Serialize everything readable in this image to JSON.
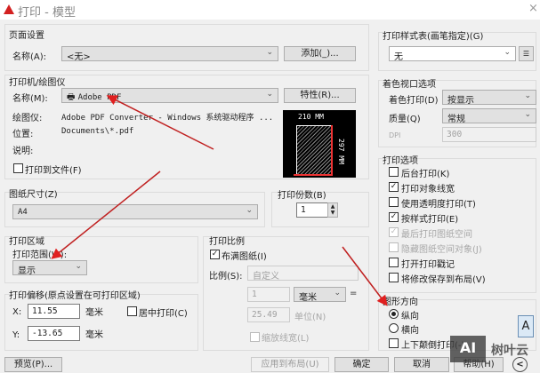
{
  "window": {
    "title": "打印 - 模型",
    "close": "×"
  },
  "page_setup": {
    "title": "页面设置",
    "name_label": "名称(A):",
    "name_value": "<无>",
    "add_button": "添加(_)..."
  },
  "printer": {
    "title": "打印机/绘图仪",
    "name_label": "名称(M):",
    "name_value": "Adobe PDF",
    "properties_button": "特性(R)...",
    "plotter_label": "绘图仪:",
    "plotter_value": "Adobe PDF Converter - Windows 系统驱动程序 ...",
    "location_label": "位置:",
    "location_value": "Documents\\*.pdf",
    "description_label": "说明:",
    "print_to_file": "打印到文件(F)",
    "preview_width": "210 MM",
    "preview_height": "297 MM"
  },
  "paper_size": {
    "title": "图纸尺寸(Z)",
    "value": "A4"
  },
  "copies": {
    "title": "打印份数(B)",
    "value": "1"
  },
  "print_area": {
    "title": "打印区域",
    "range_label": "打印范围(W):",
    "range_value": "显示"
  },
  "offset": {
    "title": "打印偏移(原点设置在可打印区域)",
    "x_label": "X:",
    "x_value": "11.55",
    "y_label": "Y:",
    "y_value": "-13.65",
    "unit": "毫米",
    "center": "居中打印(C)"
  },
  "scale": {
    "title": "打印比例",
    "fit": "布满图纸(I)",
    "scale_label": "比例(S):",
    "scale_value": "自定义",
    "v1": "1",
    "unit_value": "毫米",
    "equals": "=",
    "v2": "25.49",
    "units_label": "单位(N)",
    "scale_lineweights": "缩放线宽(L)"
  },
  "style_table": {
    "title": "打印样式表(画笔指定)(G)",
    "value": "无"
  },
  "shaded": {
    "title": "着色视口选项",
    "shade_label": "着色打印(D)",
    "shade_value": "按显示",
    "quality_label": "质量(Q)",
    "quality_value": "常规",
    "dpi_label": "DPI",
    "dpi_value": "300"
  },
  "options": {
    "title": "打印选项",
    "items": [
      {
        "label": "后台打印(K)",
        "checked": false,
        "disabled": false
      },
      {
        "label": "打印对象线宽",
        "checked": true,
        "disabled": false
      },
      {
        "label": "使用透明度打印(T)",
        "checked": false,
        "disabled": false
      },
      {
        "label": "按样式打印(E)",
        "checked": true,
        "disabled": false
      },
      {
        "label": "最后打印图纸空间",
        "checked": true,
        "disabled": true
      },
      {
        "label": "隐藏图纸空间对象(J)",
        "checked": false,
        "disabled": true
      },
      {
        "label": "打开打印戳记",
        "checked": false,
        "disabled": false
      },
      {
        "label": "将修改保存到布局(V)",
        "checked": false,
        "disabled": false
      }
    ]
  },
  "orientation": {
    "title": "图形方向",
    "portrait": "纵向",
    "landscape": "横向",
    "upside_down": "上下颠倒打印(-)",
    "icon_letter": "A"
  },
  "footer": {
    "preview": "预览(P)...",
    "apply": "应用到布局(U)",
    "ok": "确定",
    "cancel": "取消",
    "help": "帮助(H)",
    "collapse": "<"
  },
  "watermark": {
    "logo": "AI",
    "brand": "树叶云"
  }
}
